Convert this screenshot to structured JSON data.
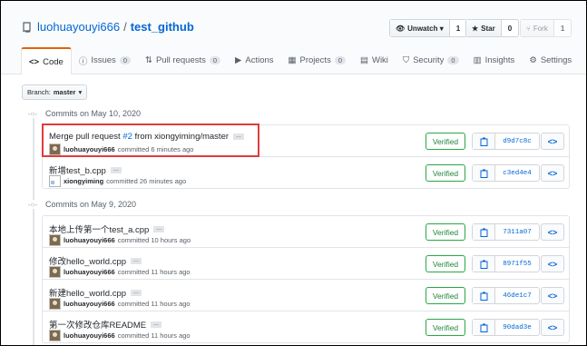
{
  "repo": {
    "owner": "luohuayouyi666",
    "separator": "/",
    "name": "test_github"
  },
  "actions": {
    "watch": {
      "label": "Unwatch ▾",
      "count": "1"
    },
    "star": {
      "label": "Star",
      "count": "0"
    },
    "fork": {
      "label": "Fork",
      "count": "1"
    }
  },
  "tabs": [
    {
      "label": "Code"
    },
    {
      "label": "Issues",
      "count": "0"
    },
    {
      "label": "Pull requests",
      "count": "0"
    },
    {
      "label": "Actions"
    },
    {
      "label": "Projects",
      "count": "0"
    },
    {
      "label": "Wiki"
    },
    {
      "label": "Security",
      "count": "0"
    },
    {
      "label": "Insights"
    },
    {
      "label": "Settings"
    }
  ],
  "branch": {
    "prefix": "Branch:",
    "name": "master"
  },
  "groups": [
    {
      "title": "Commits on May 10, 2020",
      "commits": [
        {
          "message_pre": "Merge pull request ",
          "issue": "#2",
          "message_post": " from xiongyiming/master",
          "author": "luohuayouyi666",
          "time": "committed 6 minutes ago",
          "verified": "Verified",
          "sha": "d9d7c8c",
          "ellipsis": "…"
        },
        {
          "message_pre": "新增test_b.cpp",
          "issue": "",
          "message_post": "",
          "author": "xiongyiming",
          "time": "committed 26 minutes ago",
          "verified": "Verified",
          "sha": "c3ed4e4",
          "ellipsis": "…"
        }
      ]
    },
    {
      "title": "Commits on May 9, 2020",
      "commits": [
        {
          "message_pre": "本地上传第一个test_a.cpp",
          "issue": "",
          "message_post": "",
          "author": "luohuayouyi666",
          "time": "committed 10 hours ago",
          "verified": "Verified",
          "sha": "7311a07",
          "ellipsis": "…"
        },
        {
          "message_pre": "修改hello_world.cpp",
          "issue": "",
          "message_post": "",
          "author": "luohuayouyi666",
          "time": "committed 11 hours ago",
          "verified": "Verified",
          "sha": "8971f55",
          "ellipsis": "…"
        },
        {
          "message_pre": "新建hello_world.cpp",
          "issue": "",
          "message_post": "",
          "author": "luohuayouyi666",
          "time": "committed 11 hours ago",
          "verified": "Verified",
          "sha": "46de1c7",
          "ellipsis": "…"
        },
        {
          "message_pre": "第一次修改仓库README",
          "issue": "",
          "message_post": "",
          "author": "luohuayouyi666",
          "time": "committed 11 hours ago",
          "verified": "Verified",
          "sha": "90dad3e",
          "ellipsis": "…"
        }
      ]
    }
  ],
  "colors": {
    "accent": "#0366d6",
    "active_tab": "#e36209",
    "verified": "#28a745",
    "highlight": "#e03c3c"
  }
}
